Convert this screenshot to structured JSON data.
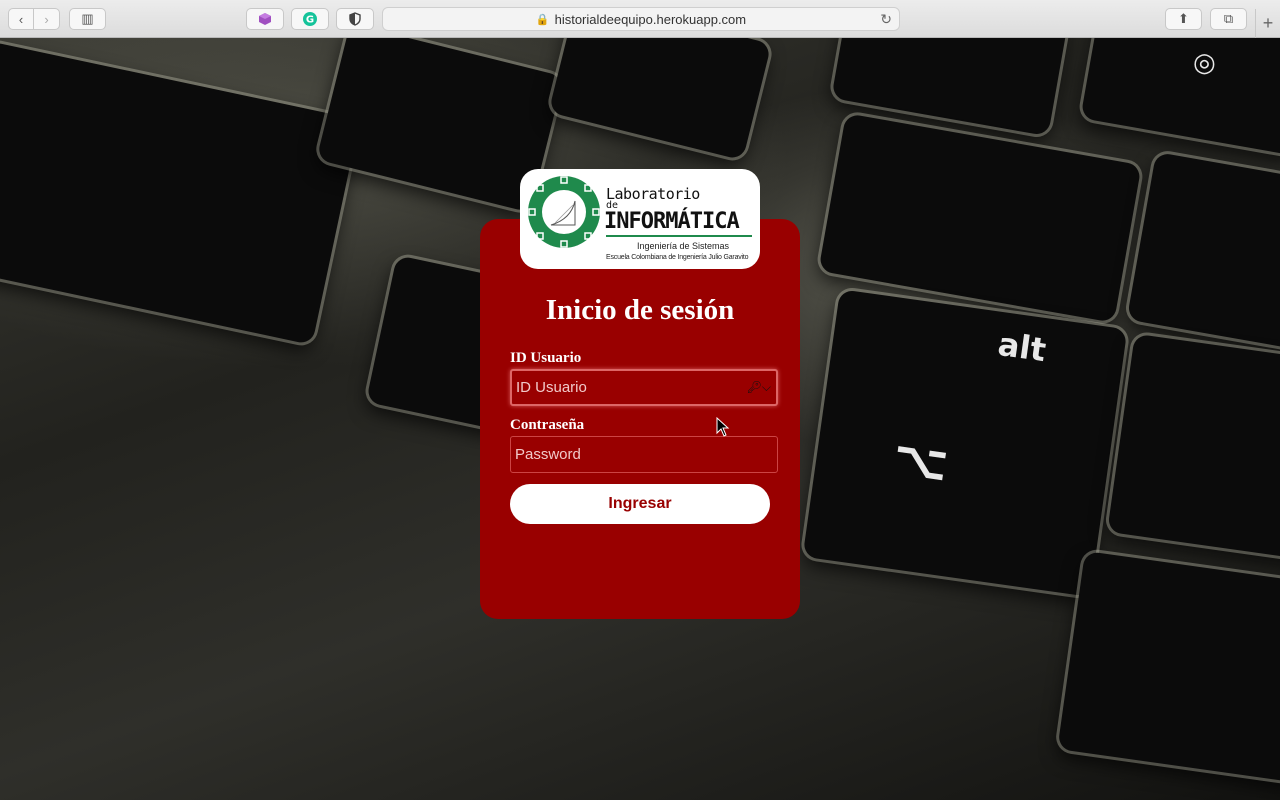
{
  "browser": {
    "url": "historialdeequipo.herokuapp.com"
  },
  "logo": {
    "line1": "Laboratorio",
    "line2": "de",
    "line3": "INFORMÁTICA",
    "subtitle": "Ingeniería de Sistemas",
    "school": "Escuela Colombiana de Ingeniería Julio Garavito"
  },
  "form": {
    "title": "Inicio de sesión",
    "user_label": "ID Usuario",
    "user_placeholder": "ID Usuario",
    "password_label": "Contraseña",
    "password_placeholder": "Password",
    "submit_label": "Ingresar"
  },
  "colors": {
    "card": "#990000",
    "button_text": "#990000",
    "logo_green": "#1f8a4c"
  }
}
